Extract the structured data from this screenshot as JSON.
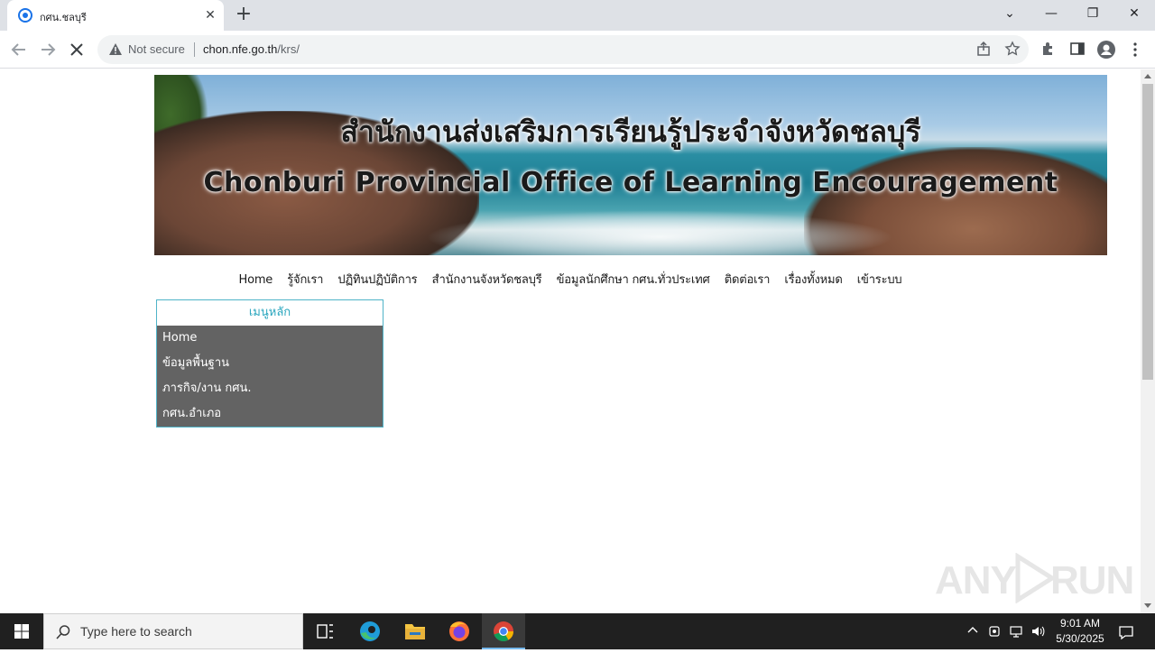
{
  "browser": {
    "tab_title": "กศน.ชลบุรี",
    "tab_close": "✕",
    "new_tab": "+",
    "security_label": "Not secure",
    "url_host": "chon.nfe.go.th",
    "url_path": "/krs/",
    "window_controls": {
      "minimize": "—",
      "restore": "❐",
      "close": "✕",
      "tab_search": "⌄"
    }
  },
  "page": {
    "banner": {
      "title_th": "สำนักงานส่งเสริมการเรียนรู้ประจำจังหวัดชลบุรี",
      "title_en": "Chonburi Provincial Office of Learning Encouragement"
    },
    "nav": [
      "Home",
      "รู้จักเรา",
      "ปฏิทินปฏิบัติการ",
      "สำนักงานจังหวัดชลบุรี",
      "ข้อมูลนักศึกษา กศน.ทั่วประเทศ",
      "ติดต่อเรา",
      "เรื่องทั้งหมด",
      "เข้าระบบ"
    ],
    "menu": {
      "heading": "เมนูหลัก",
      "items": [
        "Home",
        "ข้อมูลพื้นฐาน",
        "ภารกิจ/งาน กศน.",
        "กศน.อำเภอ"
      ]
    },
    "watermark": {
      "left": "ANY",
      "right": "RUN"
    }
  },
  "taskbar": {
    "search_placeholder": "Type here to search",
    "time": "9:01 AM",
    "date": "5/30/2025"
  },
  "colors": {
    "menu_border": "#4fb3c8",
    "menu_heading": "#2aa6be",
    "menu_body": "#636363",
    "taskbar": "#202020"
  }
}
